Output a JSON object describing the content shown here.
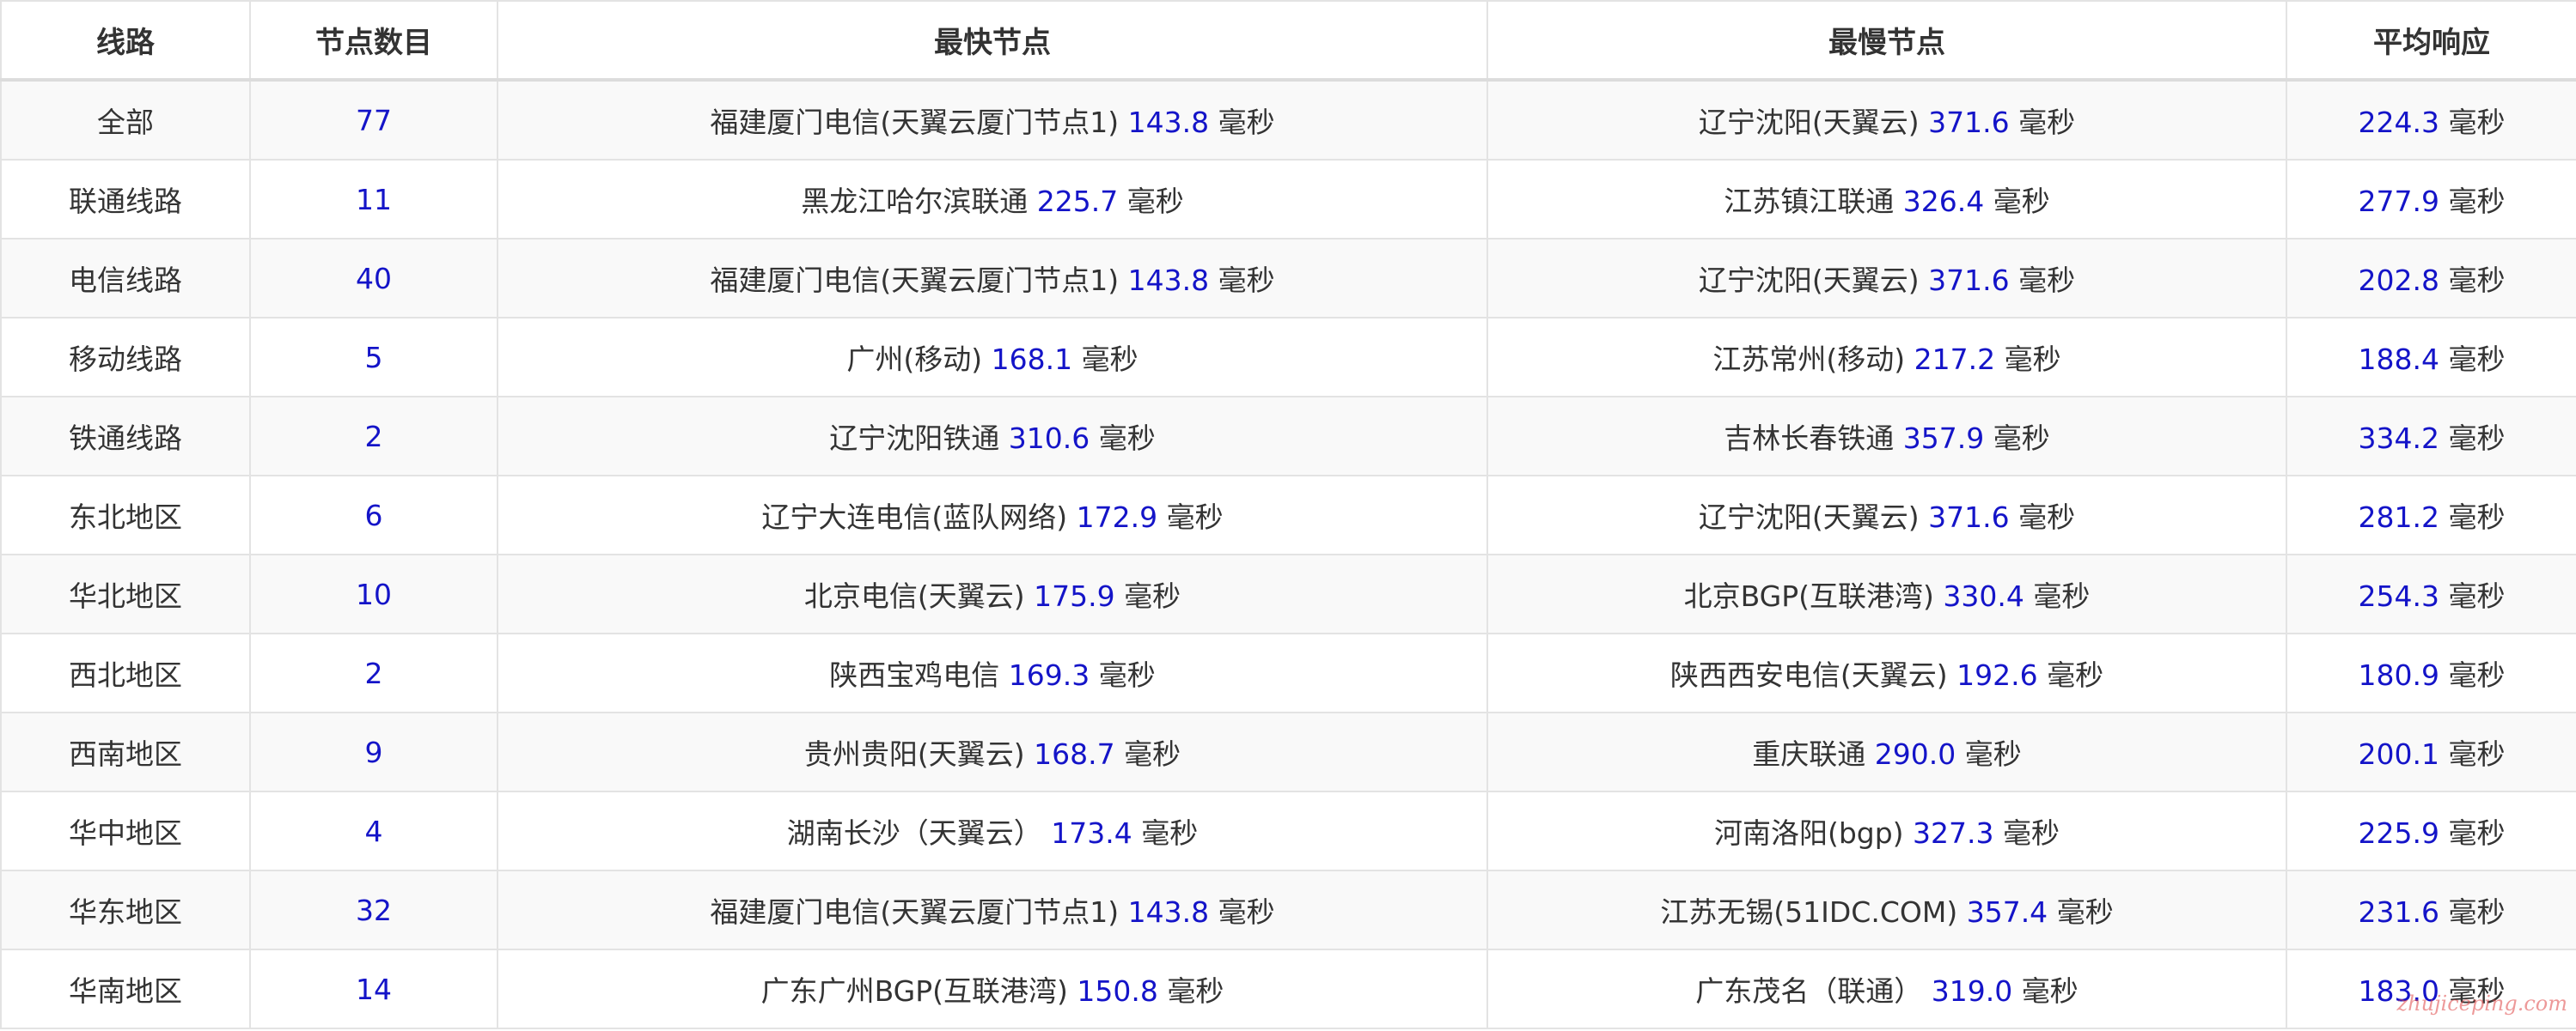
{
  "table": {
    "headers": [
      "线路",
      "节点数目",
      "最快节点",
      "最慢节点",
      "平均响应"
    ],
    "unit": "毫秒",
    "rows": [
      {
        "line": "全部",
        "count": "77",
        "fastest_name": "福建厦门电信(天翼云厦门节点1)",
        "fastest_ms": "143.8",
        "slowest_name": "辽宁沈阳(天翼云)",
        "slowest_ms": "371.6",
        "avg_ms": "224.3"
      },
      {
        "line": "联通线路",
        "count": "11",
        "fastest_name": "黑龙江哈尔滨联通",
        "fastest_ms": "225.7",
        "slowest_name": "江苏镇江联通",
        "slowest_ms": "326.4",
        "avg_ms": "277.9"
      },
      {
        "line": "电信线路",
        "count": "40",
        "fastest_name": "福建厦门电信(天翼云厦门节点1)",
        "fastest_ms": "143.8",
        "slowest_name": "辽宁沈阳(天翼云)",
        "slowest_ms": "371.6",
        "avg_ms": "202.8"
      },
      {
        "line": "移动线路",
        "count": "5",
        "fastest_name": "广州(移动)",
        "fastest_ms": "168.1",
        "slowest_name": "江苏常州(移动)",
        "slowest_ms": "217.2",
        "avg_ms": "188.4"
      },
      {
        "line": "铁通线路",
        "count": "2",
        "fastest_name": "辽宁沈阳铁通",
        "fastest_ms": "310.6",
        "slowest_name": "吉林长春铁通",
        "slowest_ms": "357.9",
        "avg_ms": "334.2"
      },
      {
        "line": "东北地区",
        "count": "6",
        "fastest_name": "辽宁大连电信(蓝队网络)",
        "fastest_ms": "172.9",
        "slowest_name": "辽宁沈阳(天翼云)",
        "slowest_ms": "371.6",
        "avg_ms": "281.2"
      },
      {
        "line": "华北地区",
        "count": "10",
        "fastest_name": "北京电信(天翼云)",
        "fastest_ms": "175.9",
        "slowest_name": "北京BGP(互联港湾)",
        "slowest_ms": "330.4",
        "avg_ms": "254.3"
      },
      {
        "line": "西北地区",
        "count": "2",
        "fastest_name": "陕西宝鸡电信",
        "fastest_ms": "169.3",
        "slowest_name": "陕西西安电信(天翼云)",
        "slowest_ms": "192.6",
        "avg_ms": "180.9"
      },
      {
        "line": "西南地区",
        "count": "9",
        "fastest_name": "贵州贵阳(天翼云)",
        "fastest_ms": "168.7",
        "slowest_name": "重庆联通",
        "slowest_ms": "290.0",
        "avg_ms": "200.1"
      },
      {
        "line": "华中地区",
        "count": "4",
        "fastest_name": "湖南长沙（天翼云）",
        "fastest_ms": "173.4",
        "slowest_name": "河南洛阳(bgp)",
        "slowest_ms": "327.3",
        "avg_ms": "225.9"
      },
      {
        "line": "华东地区",
        "count": "32",
        "fastest_name": "福建厦门电信(天翼云厦门节点1)",
        "fastest_ms": "143.8",
        "slowest_name": "江苏无锡(51IDC.COM)",
        "slowest_ms": "357.4",
        "avg_ms": "231.6"
      },
      {
        "line": "华南地区",
        "count": "14",
        "fastest_name": "广东广州BGP(互联港湾)",
        "fastest_ms": "150.8",
        "slowest_name": "广东茂名（联通）",
        "slowest_ms": "319.0",
        "avg_ms": "183.0"
      }
    ]
  },
  "colors": {
    "value_blue": "#1414c8",
    "text": "#333333",
    "stripe": "#f9f9f9",
    "border": "#e3e3e3"
  },
  "watermark": "zhujiceping.com"
}
